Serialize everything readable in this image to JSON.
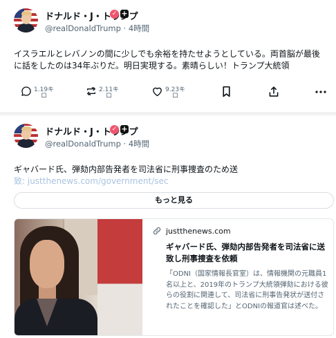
{
  "posts": [
    {
      "author": "ドナルド・J・トランプ",
      "handle": "@realDonaldTrump",
      "time": "· 4時間",
      "text": "イスラエルとレバノンの間に少しでも余裕を持たせようとしている。両首脳が最後に話をしたのは34年ぶりだ。明日実現する。素晴らしい！トランプ大統領",
      "replies": "1.19キ\nロ",
      "reposts": "2.11キ\nロ",
      "likes": "9.23キ\nロ"
    },
    {
      "author": "ドナルド・J・トランプ",
      "handle": "@realDonaldTrump",
      "time": "· 4時間",
      "text": "ギャバード氏、弾劾内部告発者を司法省に刑事捜査のため送",
      "text_link": "致: justthenews.com/government/sec",
      "more_label": "もっと見る",
      "card": {
        "domain": "justthenews.com",
        "title": "ギャバード氏、弾劾内部告発者を司法省に送致し刑事捜査を依頼",
        "description": "「ODNI（国家情報長官室）は、情報機関の元職員1名以上と、2019年のトランプ大統領弾劾における彼らの役割に関連して、司法省に刑事告発状が送付されたことを確認した」とODNIの報道官は述べた。"
      }
    }
  ],
  "icons": [
    "reply-icon",
    "repost-icon",
    "like-icon",
    "bookmark-icon",
    "share-icon",
    "more-icon",
    "verified-badge-icon",
    "plus-badge-icon",
    "link-icon"
  ],
  "colors": {
    "badge": "#f0556c",
    "muted": "#536471",
    "link": "#a9c3e0"
  }
}
